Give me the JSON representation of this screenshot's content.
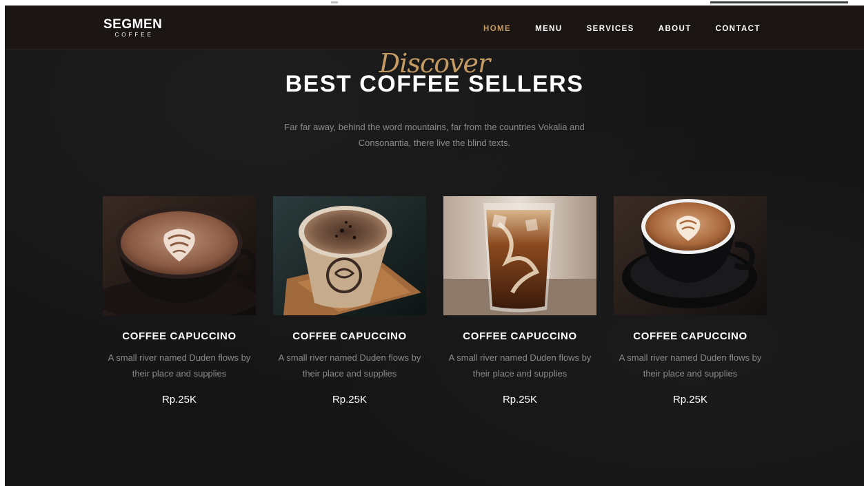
{
  "brand": {
    "title": "SEGMEN",
    "subtitle": "COFFEE"
  },
  "nav": {
    "items": [
      "HOME",
      "MENU",
      "SERVICES",
      "ABOUT",
      "CONTACT"
    ],
    "active": "HOME"
  },
  "hero": {
    "script": "Discover",
    "heading": "BEST COFFEE SELLERS",
    "intro": "Far far away, behind the word mountains, far from the countries Vokalia and Consonantia, there live the blind texts."
  },
  "products": [
    {
      "image": "latte-art-cup-photo",
      "name": "COFFEE CAPUCCINO",
      "desc": "A small river named Duden flows by their place and supplies",
      "price": "Rp.25K"
    },
    {
      "image": "paper-cup-coffee-photo",
      "name": "COFFEE CAPUCCINO",
      "desc": "A small river named Duden flows by their place and supplies",
      "price": "Rp.25K"
    },
    {
      "image": "iced-coffee-glass-photo",
      "name": "COFFEE CAPUCCINO",
      "desc": "A small river named Duden flows by their place and supplies",
      "price": "Rp.25K"
    },
    {
      "image": "black-cup-latte-photo",
      "name": "COFFEE CAPUCCINO",
      "desc": "A small river named Duden flows by their place and supplies",
      "price": "Rp.25K"
    }
  ],
  "colors": {
    "accent": "#c49b63",
    "navbar": "#1b1614",
    "background": "#151515",
    "text_muted": "#8b8b8b"
  }
}
